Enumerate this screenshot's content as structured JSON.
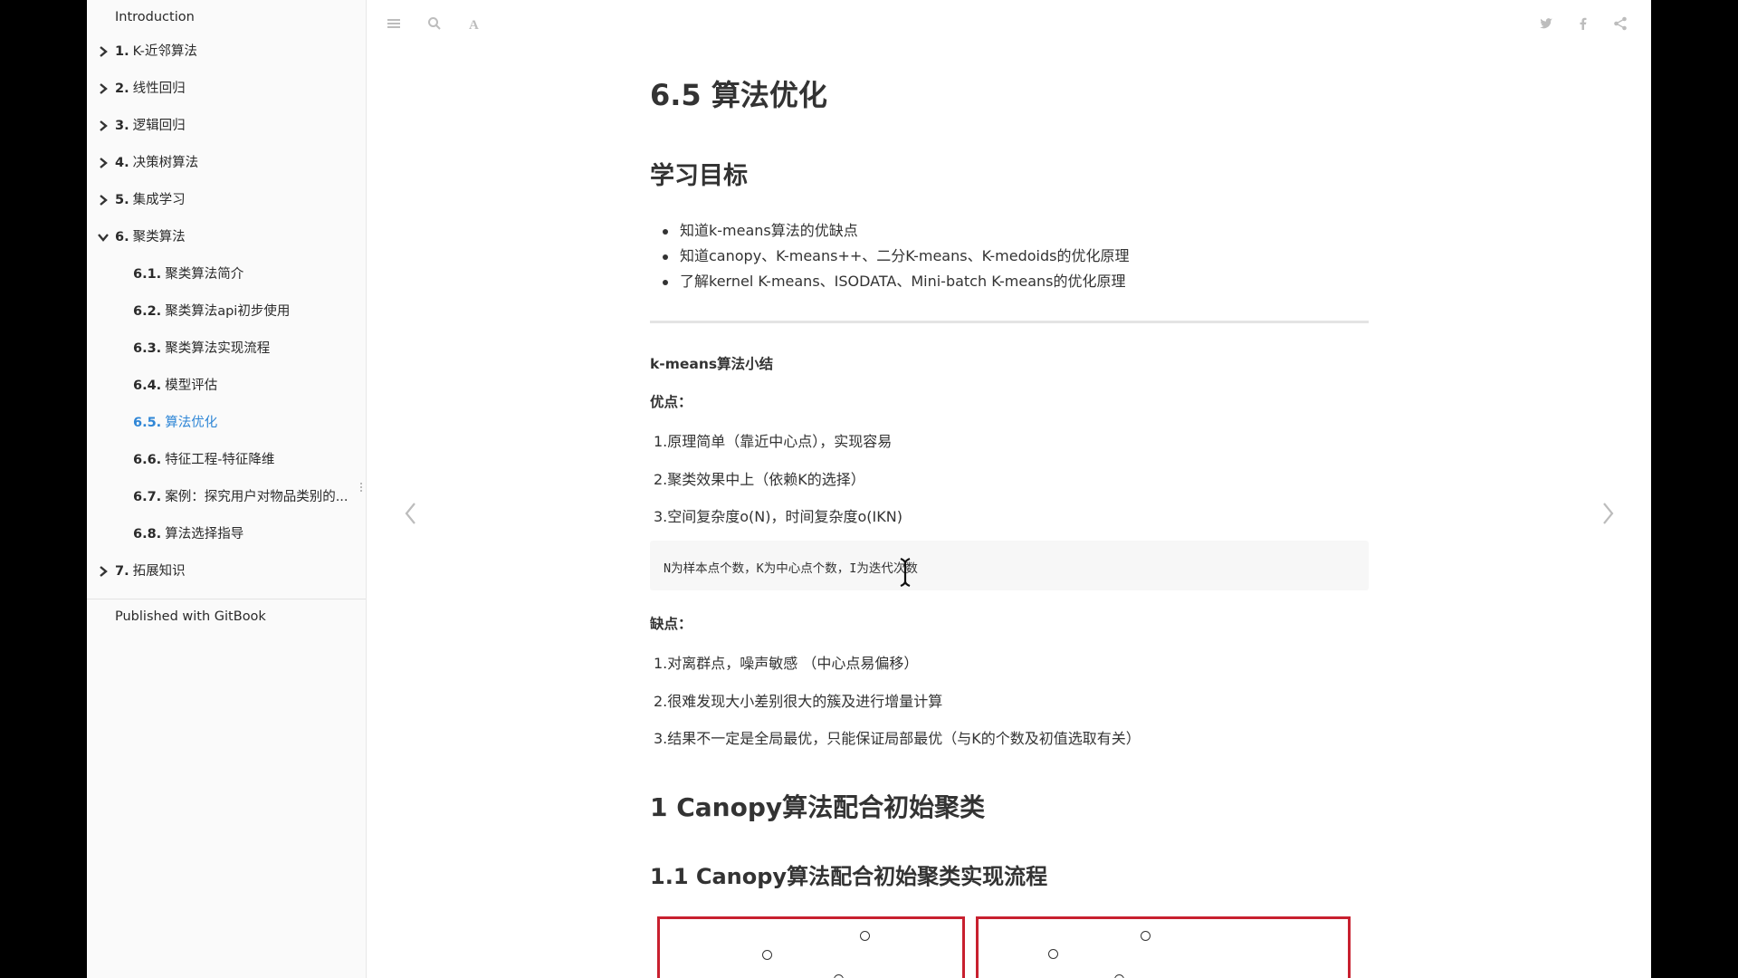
{
  "sidebar": {
    "items": [
      {
        "num": "",
        "label": "Introduction",
        "chevron": "none"
      },
      {
        "num": "1.",
        "label": "K-近邻算法",
        "chevron": "right"
      },
      {
        "num": "2.",
        "label": "线性回归",
        "chevron": "right"
      },
      {
        "num": "3.",
        "label": "逻辑回归",
        "chevron": "right"
      },
      {
        "num": "4.",
        "label": "决策树算法",
        "chevron": "right"
      },
      {
        "num": "5.",
        "label": "集成学习",
        "chevron": "right"
      },
      {
        "num": "6.",
        "label": "聚类算法",
        "chevron": "down"
      },
      {
        "num": "6.1.",
        "label": "聚类算法简介"
      },
      {
        "num": "6.2.",
        "label": "聚类算法api初步使用"
      },
      {
        "num": "6.3.",
        "label": "聚类算法实现流程"
      },
      {
        "num": "6.4.",
        "label": "模型评估"
      },
      {
        "num": "6.5.",
        "label": "算法优化",
        "active": true
      },
      {
        "num": "6.6.",
        "label": "特征工程-特征降维"
      },
      {
        "num": "6.7.",
        "label": "案例：探究用户对物品类别的..."
      },
      {
        "num": "6.8.",
        "label": "算法选择指导"
      },
      {
        "num": "7.",
        "label": "拓展知识",
        "chevron": "right"
      }
    ],
    "published": "Published with GitBook"
  },
  "toolbar": {
    "left_icons": [
      "menu-icon",
      "search-icon",
      "font-settings-icon"
    ],
    "right_icons": [
      "twitter-icon",
      "facebook-icon",
      "share-icon"
    ]
  },
  "content": {
    "title": "6.5 算法优化",
    "goals_heading": "学习目标",
    "goals": [
      "知道k-means算法的优缺点",
      "知道canopy、K-means++、二分K-means、K-medoids的优化原理",
      "了解kernel K-means、ISODATA、Mini-batch K-means的优化原理"
    ],
    "summary_heading": "k-means算法小结",
    "pros_label": "优点：",
    "pros": [
      "1.原理简单（靠近中心点），实现容易",
      "2.聚类效果中上（依赖K的选择）",
      "3.空间复杂度o(N)，时间复杂度o(IKN)"
    ],
    "code_note": "N为样本点个数，K为中心点个数，I为迭代次数",
    "cons_label": "缺点：",
    "cons": [
      "1.对离群点，噪声敏感 （中心点易偏移）",
      "2.很难发现大小差别很大的簇及进行增量计算",
      "3.结果不一定是全局最优，只能保证局部最优（与K的个数及初值选取有关）"
    ],
    "section1": "1 Canopy算法配合初始聚类",
    "section1_1": "1.1 Canopy算法配合初始聚类实现流程"
  },
  "colors": {
    "accent": "#2f86d6",
    "figure_border": "#c8202f",
    "sidebar_bg": "#fafafa"
  }
}
